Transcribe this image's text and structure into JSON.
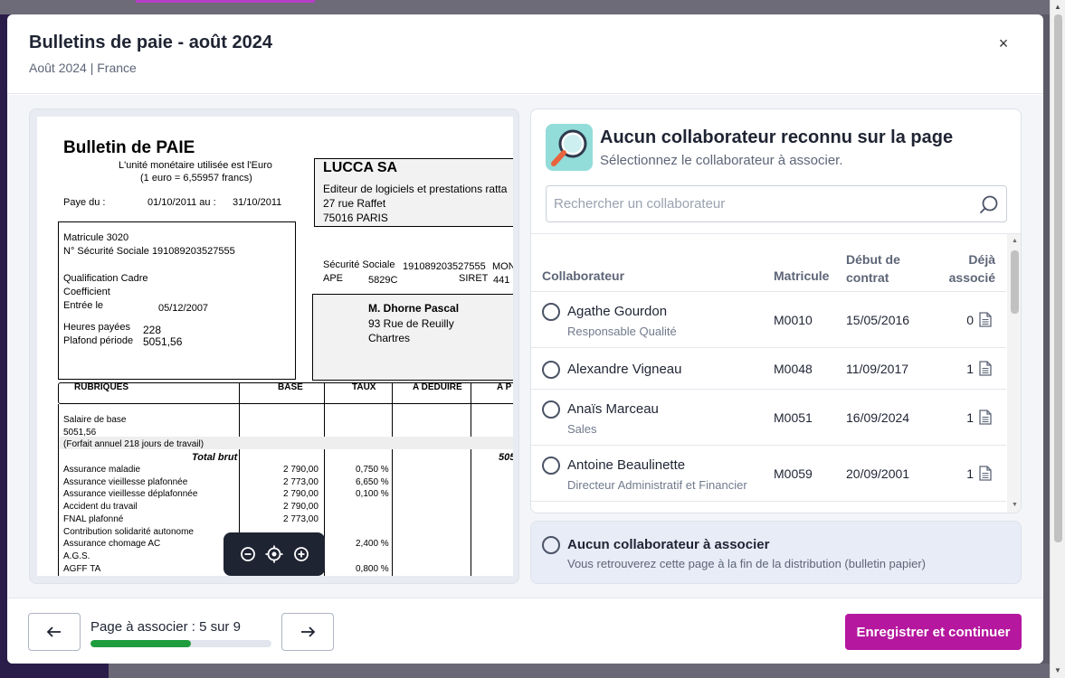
{
  "colors": {
    "primary": "#b5179e",
    "progress": "#1f9d3e",
    "text": "#1f2433",
    "muted": "#5d6577",
    "panel_bg": "#f4f5f9",
    "selected_bg": "#e8ecf7"
  },
  "modal": {
    "title": "Bulletins de paie - août 2024",
    "subtitle": "Août 2024 | France",
    "close_label": "×"
  },
  "document": {
    "title": "Bulletin de PAIE",
    "currency_line1": "L'unité monétaire utilisée est l'Euro",
    "currency_line2": "(1 euro = 6,55957 francs)",
    "pay_label": "Paye du :",
    "pay_from": "01/10/2011 au :",
    "pay_to": "31/10/2011",
    "company_name": "LUCCA SA",
    "company_desc": "Editeur de logiciels et prestations ratta",
    "company_street": "27 rue Raffet",
    "company_city": "75016 PARIS",
    "matricule": "Matricule 3020",
    "secu_line": "N° Sécurité Sociale 191089203527555",
    "qualification": "Qualification Cadre",
    "coefficient": "Coefficient",
    "entree_label": "Entrée le",
    "entree_date": "05/12/2007",
    "heures_label": "Heures payées",
    "heures_value": "228",
    "plafond_label": "Plafond période",
    "plafond_value": "5051,56",
    "ss_label": "Sécurité Sociale",
    "ss_value": "191089203527555",
    "ss_extra": "MON",
    "ape_label": "APE",
    "ape_value": "5829C",
    "siret_label": "SIRET",
    "siret_value": "441",
    "employee_name": "M. Dhorne Pascal",
    "employee_street": "93 Rue de Reuilly",
    "employee_city": "Chartres",
    "headers": [
      "RUBRIQUES",
      "BASE",
      "TAUX",
      "A DEDUIRE",
      "A P"
    ],
    "salaire_base": "Salaire de base",
    "salaire_value": "5051,56",
    "forfait": "(Forfait annuel 218 jours de travail)",
    "total_brut": "Total brut",
    "total_brut_value": "505",
    "lines": [
      {
        "label": "Assurance maladie",
        "base": "2 790,00",
        "taux": "0,750 %"
      },
      {
        "label": "Assurance vieillesse plafonnée",
        "base": "2 773,00",
        "taux": "6,650 %"
      },
      {
        "label": "Assurance vieillesse déplafonnée",
        "base": "2 790,00",
        "taux": "0,100 %"
      },
      {
        "label": "Accident du travail",
        "base": "2 790,00",
        "taux": ""
      },
      {
        "label": "FNAL plafonné",
        "base": "2 773,00",
        "taux": ""
      },
      {
        "label": "Contribution solidarité autonome",
        "base": "",
        "taux": ""
      },
      {
        "label": "Assurance chomage AC",
        "base": "",
        "taux": "2,400 %"
      },
      {
        "label": "A.G.S.",
        "base": "",
        "taux": ""
      },
      {
        "label": "AGFF TA",
        "base": "",
        "taux": "0,800 %"
      }
    ]
  },
  "zoom": {
    "zoom_out": "zoom-out-icon",
    "recenter": "recenter-icon",
    "zoom_in": "zoom-in-icon"
  },
  "match": {
    "title": "Aucun collaborateur reconnu sur la page",
    "subtitle": "Sélectionnez le collaborateur à associer.",
    "search_placeholder": "Rechercher un collaborateur",
    "columns": {
      "collaborator": "Collaborateur",
      "matricule": "Matricule",
      "start_line1": "Début de",
      "start_line2": "contrat",
      "already_line1": "Déjà",
      "already_line2": "associé"
    },
    "rows": [
      {
        "name": "Agathe Gourdon",
        "job": "Responsable Qualité",
        "matricule": "M0010",
        "start": "15/05/2016",
        "count": "0"
      },
      {
        "name": "Alexandre Vigneau",
        "job": "",
        "matricule": "M0048",
        "start": "11/09/2017",
        "count": "1"
      },
      {
        "name": "Anaïs Marceau",
        "job": "Sales",
        "matricule": "M0051",
        "start": "16/09/2024",
        "count": "1"
      },
      {
        "name": "Antoine Beaulinette",
        "job": "Directeur Administratif et Financier",
        "matricule": "M0059",
        "start": "20/09/2001",
        "count": "1"
      }
    ],
    "none_title": "Aucun collaborateur à associer",
    "none_subtitle": "Vous retrouverez cette page à la fin de la distribution (bulletin papier)"
  },
  "footer": {
    "page_label": "Page à associer : 5 sur 9",
    "progress_fraction": 0.555,
    "save_label": "Enregistrer et continuer"
  }
}
